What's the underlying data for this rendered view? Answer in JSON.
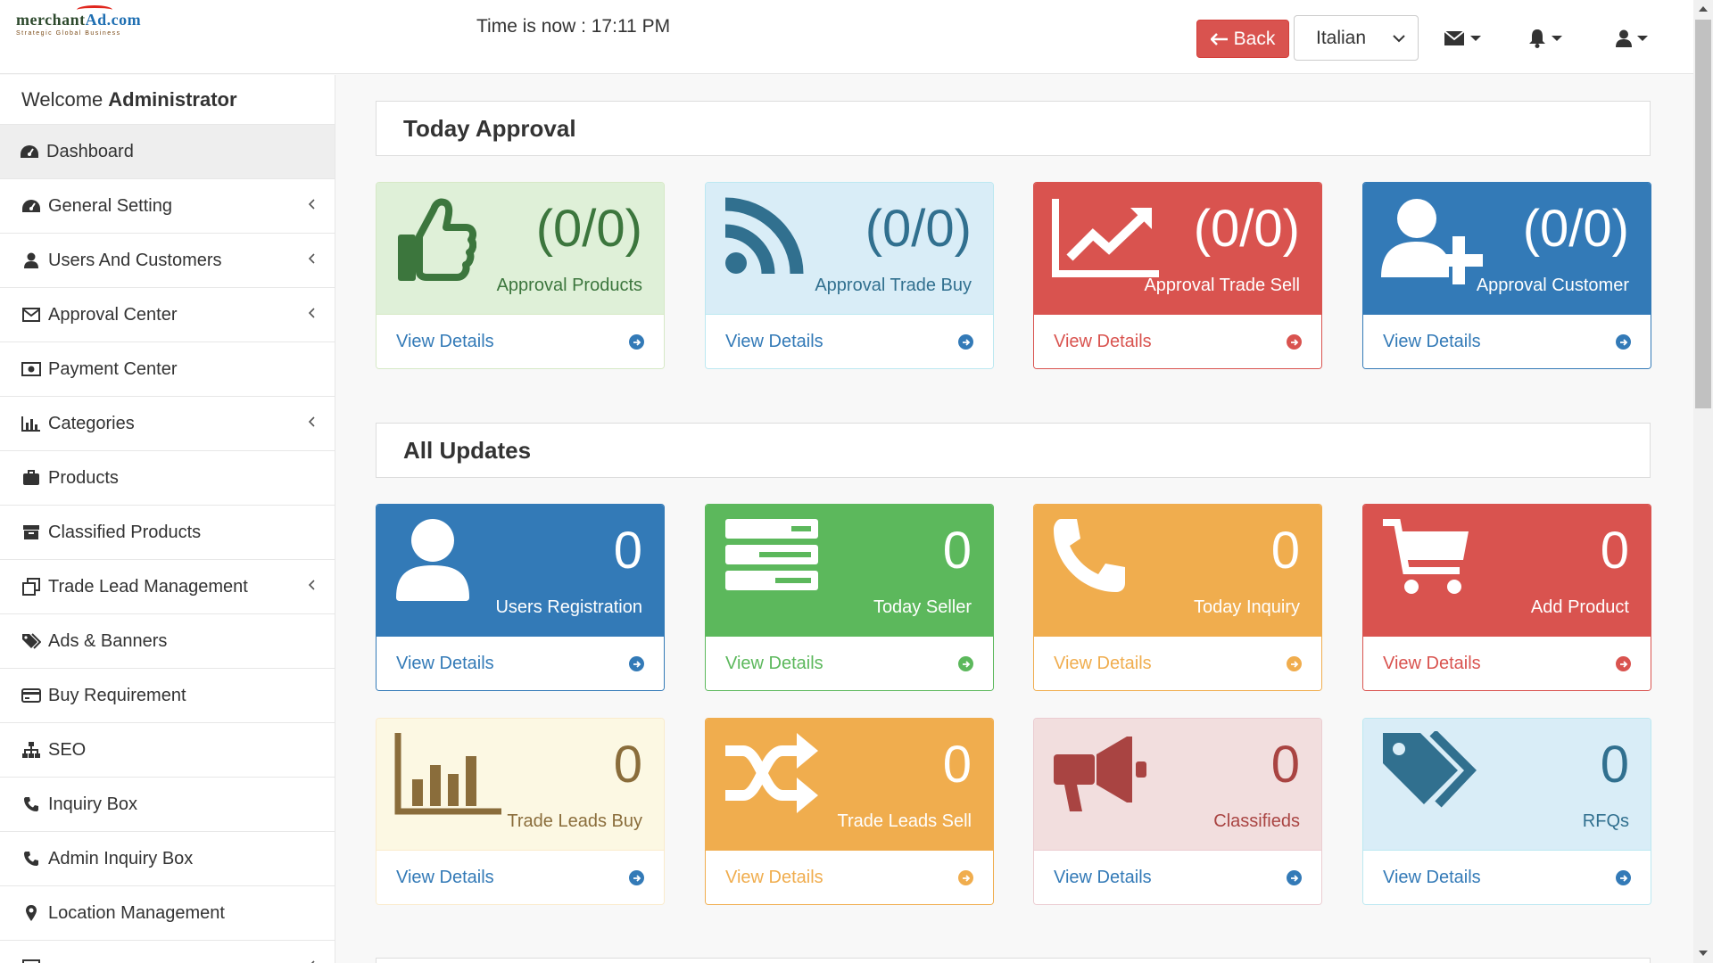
{
  "header": {
    "logo_name_a": "merchant",
    "logo_name_b": "Ad.com",
    "logo_tagline": "Strategic Global Business",
    "clock": "Time is now : 17:11 PM",
    "back_label": "Back",
    "language": "Italian"
  },
  "colors": {
    "success_bg": "#dff0d8",
    "info_bg": "#d9edf7",
    "danger": "#d9534f",
    "primary": "#337ab7",
    "green": "#5cb85c",
    "yellow": "#f0ad4e"
  },
  "sidebar": {
    "welcome_prefix": "Welcome",
    "welcome_user": "Administrator",
    "items": [
      {
        "label": "Dashboard",
        "icon": "dashboard-icon"
      },
      {
        "label": "General Setting",
        "icon": "dashboard-icon"
      },
      {
        "label": "Users And Customers",
        "icon": "user-icon"
      },
      {
        "label": "Approval Center",
        "icon": "envelope-icon"
      },
      {
        "label": "Payment Center",
        "icon": "money-icon"
      },
      {
        "label": "Categories",
        "icon": "bar-chart-icon"
      },
      {
        "label": "Products",
        "icon": "briefcase-icon"
      },
      {
        "label": "Classified Products",
        "icon": "archive-icon"
      },
      {
        "label": "Trade Lead Management",
        "icon": "clone-icon"
      },
      {
        "label": "Ads & Banners",
        "icon": "tags-icon"
      },
      {
        "label": "Buy Requirement",
        "icon": "credit-card-icon"
      },
      {
        "label": "SEO",
        "icon": "sitemap-icon"
      },
      {
        "label": "Inquiry Box",
        "icon": "phone-icon"
      },
      {
        "label": "Admin Inquiry Box",
        "icon": "phone-icon"
      },
      {
        "label": "Location Management",
        "icon": "map-marker-icon"
      }
    ]
  },
  "sections": {
    "today_approval": "Today Approval",
    "all_updates": "All Updates"
  },
  "cards": {
    "view_details": "View Details",
    "approval_products": {
      "count": "(0/0)",
      "label": "Approval Products"
    },
    "approval_trade_buy": {
      "count": "(0/0)",
      "label": "Approval Trade Buy"
    },
    "approval_trade_sell": {
      "count": "(0/0)",
      "label": "Approval Trade Sell"
    },
    "approval_customer": {
      "count": "(0/0)",
      "label": "Approval Customer"
    },
    "users_registration": {
      "count": "0",
      "label": "Users Registration"
    },
    "today_seller": {
      "count": "0",
      "label": "Today Seller"
    },
    "today_inquiry": {
      "count": "0",
      "label": "Today Inquiry"
    },
    "add_product": {
      "count": "0",
      "label": "Add Product"
    },
    "trade_leads_buy": {
      "count": "0",
      "label": "Trade Leads Buy"
    },
    "trade_leads_sell": {
      "count": "0",
      "label": "Trade Leads Sell"
    },
    "classifieds": {
      "count": "0",
      "label": "Classifieds"
    },
    "rfqs": {
      "count": "0",
      "label": "RFQs"
    }
  }
}
